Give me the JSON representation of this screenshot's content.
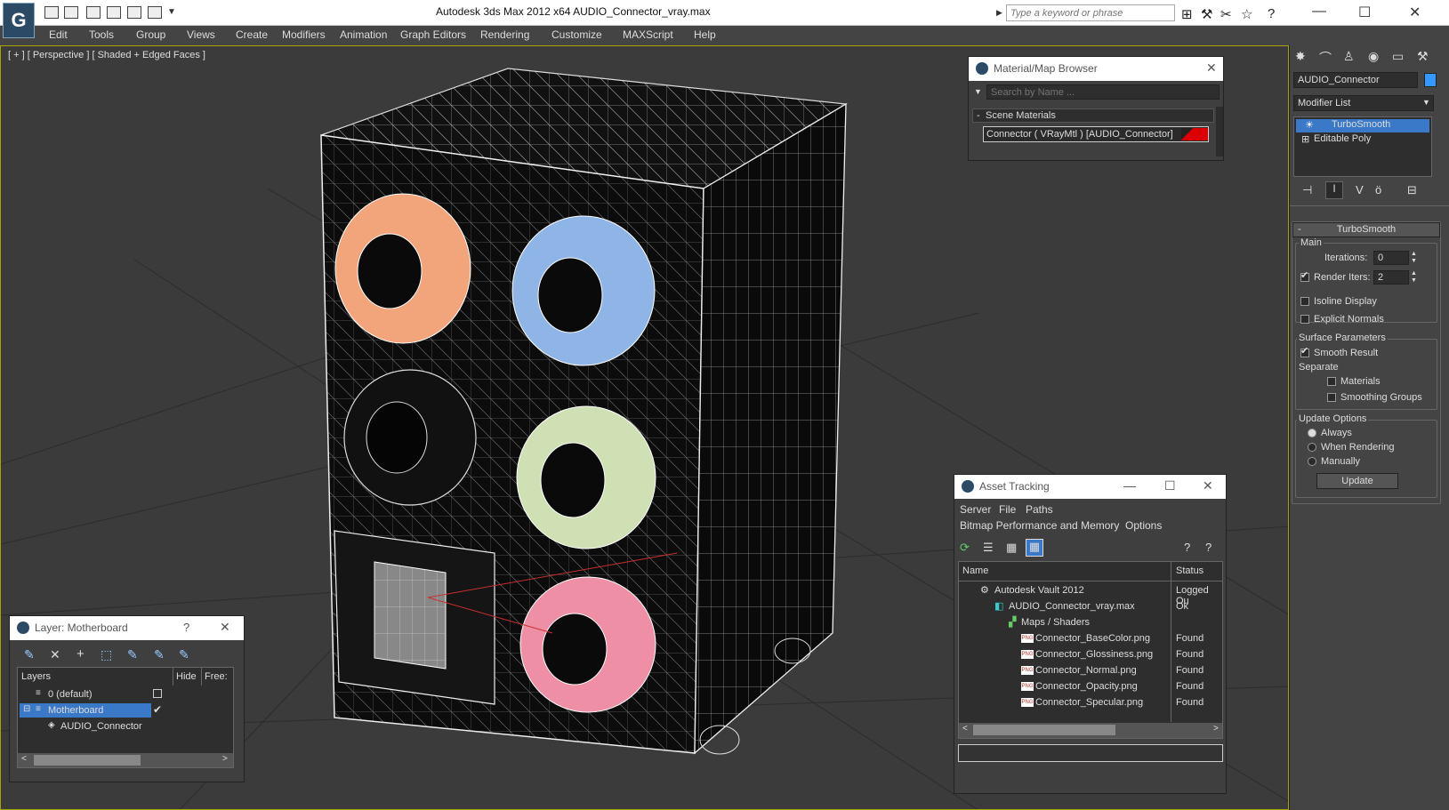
{
  "title": "Autodesk 3ds Max  2012 x64      AUDIO_Connector_vray.max",
  "search": {
    "placeholder": "Type a keyword or phrase"
  },
  "menu": [
    "Edit",
    "Tools",
    "Group",
    "Views",
    "Create",
    "Modifiers",
    "Animation",
    "Graph Editors",
    "Rendering",
    "Customize",
    "MAXScript",
    "Help"
  ],
  "viewport": {
    "label": "[ + ] [ Perspective ] [ Shaded + Edged Faces ]"
  },
  "material_browser": {
    "title": "Material/Map Browser",
    "search_placeholder": "Search by Name ...",
    "group": "Scene Materials",
    "item": "Connector  ( VRayMtl )  [AUDIO_Connector]"
  },
  "cmd": {
    "object_name": "AUDIO_Connector",
    "modifier_list": "Modifier List",
    "stack": [
      "TurboSmooth",
      "Editable Poly"
    ],
    "rollout": "TurboSmooth",
    "main": "Main",
    "iterations_label": "Iterations:",
    "iterations": "0",
    "render_iters_label": "Render Iters:",
    "render_iters": "2",
    "isoline": "Isoline Display",
    "explicit_normals": "Explicit Normals",
    "surface_params": "Surface Parameters",
    "smooth_result": "Smooth Result",
    "separate": "Separate",
    "materials": "Materials",
    "smoothing_groups": "Smoothing Groups",
    "update_options": "Update Options",
    "always": "Always",
    "when_rendering": "When Rendering",
    "manually": "Manually",
    "update_btn": "Update"
  },
  "layer": {
    "title": "Layer: Motherboard",
    "help": "?",
    "col_layers": "Layers",
    "col_hide": "Hide",
    "col_freeze": "Free:",
    "rows": [
      "0 (default)",
      "Motherboard",
      "AUDIO_Connector"
    ]
  },
  "asset": {
    "title": "Asset Tracking",
    "menu1": [
      "Server",
      "File",
      "Paths"
    ],
    "menu2": [
      "Bitmap Performance and Memory",
      "Options"
    ],
    "col_name": "Name",
    "col_status": "Status",
    "rows": [
      {
        "name": "Autodesk Vault 2012",
        "status": "Logged Ou"
      },
      {
        "name": "AUDIO_Connector_vray.max",
        "status": "Ok"
      },
      {
        "name": "Maps / Shaders",
        "status": ""
      },
      {
        "name": "Connector_BaseColor.png",
        "status": "Found"
      },
      {
        "name": "Connector_Glossiness.png",
        "status": "Found"
      },
      {
        "name": "Connector_Normal.png",
        "status": "Found"
      },
      {
        "name": "Connector_Opacity.png",
        "status": "Found"
      },
      {
        "name": "Connector_Specular.png",
        "status": "Found"
      }
    ]
  },
  "colors": {
    "accent": "#3399ff",
    "viewport_border": "#a7a400",
    "ring_orange": "#f2a57a",
    "ring_blue": "#8fb4e6",
    "ring_green": "#cfe0b4",
    "ring_pink": "#ee8fa6"
  }
}
